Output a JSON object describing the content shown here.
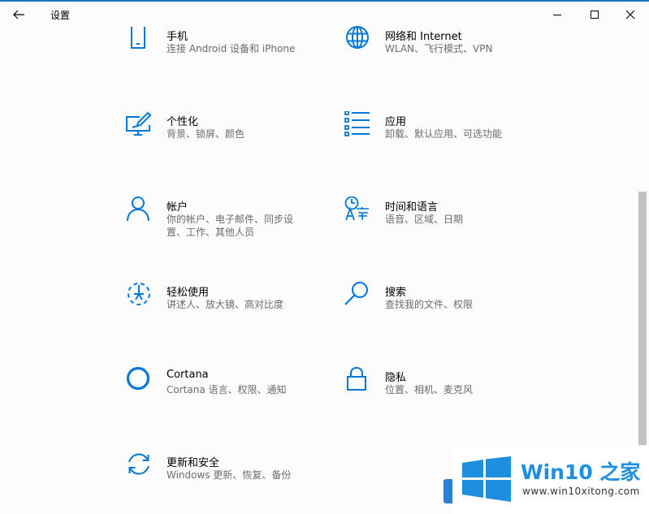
{
  "window": {
    "title": "设置",
    "back_icon": "back-arrow-icon",
    "controls": [
      "minimize-icon",
      "maximize-icon",
      "close-icon"
    ]
  },
  "theme": {
    "accent": "#0078d7",
    "text": "#000000",
    "secondary_text": "#6b6b6b",
    "background": "#fcfcfc"
  },
  "categories": [
    {
      "icon": "phone-icon",
      "name": "手机",
      "desc": "连接 Android 设备和 iPhone"
    },
    {
      "icon": "globe-icon",
      "name": "网络和 Internet",
      "desc": "WLAN、飞行模式、VPN"
    },
    {
      "icon": "personalization-icon",
      "name": "个性化",
      "desc": "背景、锁屏、颜色"
    },
    {
      "icon": "apps-icon",
      "name": "应用",
      "desc": "卸载、默认应用、可选功能"
    },
    {
      "icon": "person-icon",
      "name": "帐户",
      "desc": "你的帐户、电子邮件、同步设置、工作、其他人员"
    },
    {
      "icon": "time-language-icon",
      "name": "时间和语言",
      "desc": "语音、区域、日期"
    },
    {
      "icon": "ease-of-access-icon",
      "name": "轻松使用",
      "desc": "讲述人、放大镜、高对比度"
    },
    {
      "icon": "search-icon",
      "name": "搜索",
      "desc": "查找我的文件、权限"
    },
    {
      "icon": "cortana-icon",
      "name": "Cortana",
      "desc": "Cortana 语言、权限、通知"
    },
    {
      "icon": "lock-icon",
      "name": "隐私",
      "desc": "位置、相机、麦克风"
    },
    {
      "icon": "update-icon",
      "name": "更新和安全",
      "desc": "Windows 更新、恢复、备份"
    }
  ],
  "watermark": {
    "brand": "Win10 之家",
    "site": "www.win10xitong.com",
    "color": "#1e8ee0"
  }
}
